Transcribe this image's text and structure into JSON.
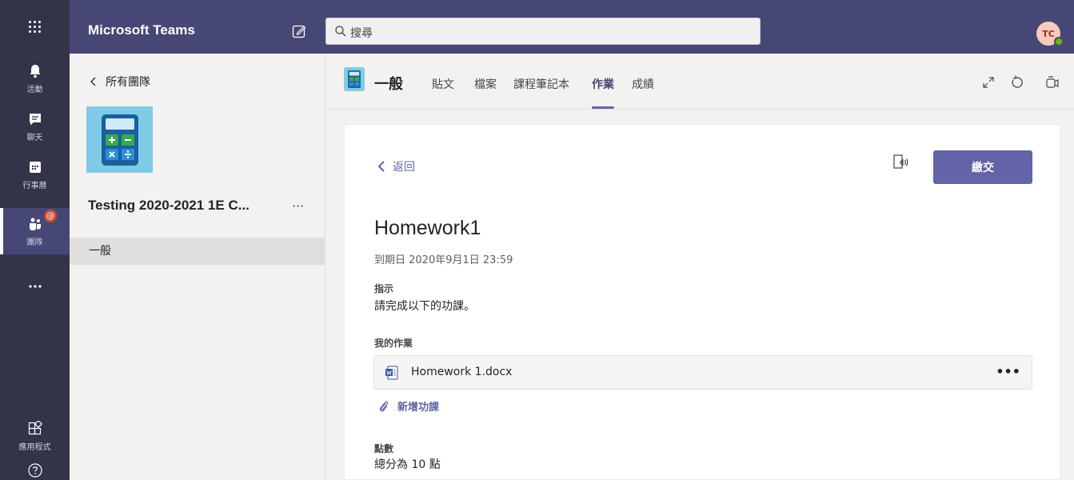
{
  "app": {
    "title": "Microsoft Teams"
  },
  "search": {
    "placeholder": "搜尋"
  },
  "user": {
    "initials": "TC"
  },
  "rail": {
    "items": [
      {
        "label": "活動",
        "icon": "bell-icon"
      },
      {
        "label": "聊天",
        "icon": "chat-icon"
      },
      {
        "label": "行事曆",
        "icon": "calendar-icon"
      },
      {
        "label": "團隊",
        "icon": "teams-icon",
        "badge": "@"
      },
      {
        "label": "",
        "icon": "more-icon"
      },
      {
        "label": "應用程式",
        "icon": "apps-icon"
      },
      {
        "label": "",
        "icon": "help-icon"
      }
    ]
  },
  "team_panel": {
    "back_label": "所有團隊",
    "team_name": "Testing 2020-2021 1E C...",
    "more": "···",
    "channel": "一般"
  },
  "channel_header": {
    "name": "一般",
    "tabs": [
      {
        "label": "貼文"
      },
      {
        "label": "檔案"
      },
      {
        "label": "課程筆記本"
      },
      {
        "label": "作業"
      },
      {
        "label": "成績"
      }
    ]
  },
  "assignment": {
    "back_label": "返回",
    "submit_label": "繳交",
    "title": "Homework1",
    "due": "到期日 2020年9月1日 23:59",
    "instructions_label": "指示",
    "instructions": "請完成以下的功課。",
    "my_work_label": "我的作業",
    "file_name": "Homework 1.docx",
    "file_more": "•••",
    "add_work_label": "新增功課",
    "points_label": "點數",
    "points_text": "總分為 10 點"
  },
  "colors": {
    "accent": "#6264a7",
    "topbar": "#464775",
    "rail": "#33344a"
  }
}
